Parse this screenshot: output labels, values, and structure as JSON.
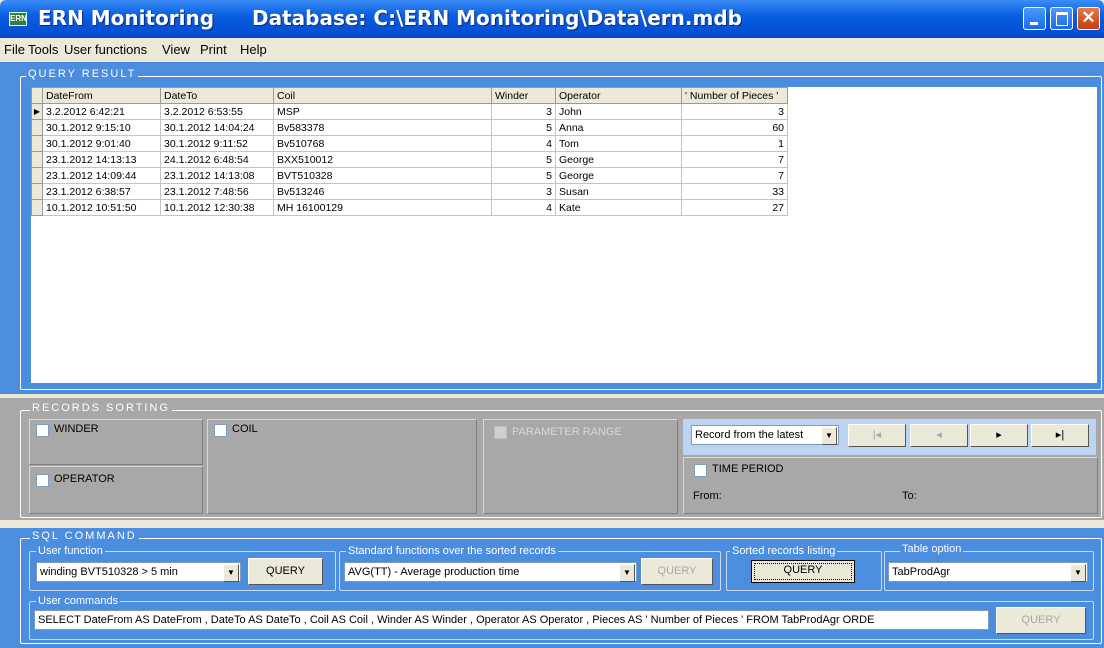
{
  "window": {
    "app_title": "ERN Monitoring",
    "db_title": "Database: C:\\ERN Monitoring\\Data\\ern.mdb",
    "icon_text": "ERN"
  },
  "menu": [
    "File",
    "Tools",
    "User functions",
    "View",
    "Print",
    "Help"
  ],
  "query_result": {
    "legend": "QUERY RESULT",
    "columns": [
      "DateFrom",
      "DateTo",
      "Coil",
      "Winder",
      "Operator",
      "' Number of Pieces '"
    ],
    "rows": [
      [
        "3.2.2012 6:42:21",
        "3.2.2012 6:53:55",
        "MSP",
        "3",
        "John",
        "3"
      ],
      [
        "30.1.2012 9:15:10",
        "30.1.2012 14:04:24",
        "Bv583378",
        "5",
        "Anna",
        "60"
      ],
      [
        "30.1.2012 9:01:40",
        "30.1.2012 9:11:52",
        "Bv510768",
        "4",
        "Tom",
        "1"
      ],
      [
        "23.1.2012 14:13:13",
        "24.1.2012 6:48:54",
        "BXX510012",
        "5",
        "George",
        "7"
      ],
      [
        "23.1.2012 14:09:44",
        "23.1.2012 14:13:08",
        "BVT510328",
        "5",
        "George",
        "7"
      ],
      [
        "23.1.2012 6:38:57",
        "23.1.2012 7:48:56",
        "Bv513246",
        "3",
        "Susan",
        "33"
      ],
      [
        "10.1.2012 10:51:50",
        "10.1.2012 12:30:38",
        "MH 16100129",
        "4",
        "Kate",
        "27"
      ]
    ]
  },
  "sorting": {
    "legend": "RECORDS SORTING",
    "winder": "WINDER",
    "operator": "OPERATOR",
    "coil": "COIL",
    "parameter_range": "PARAMETER RANGE",
    "record_order": "Record from the latest",
    "nav": [
      "|◂",
      "◂",
      "▸",
      "▸|"
    ],
    "time_period": "TIME PERIOD",
    "from": "From:",
    "to": "To:"
  },
  "sql": {
    "legend": "SQL COMMAND",
    "user_function_label": "User function",
    "user_function_value": "winding BVT510328 > 5 min",
    "query": "QUERY",
    "standard_label": "Standard functions over the sorted records",
    "standard_value": "AVG(TT) - Average production time",
    "sorted_label": "Sorted records listing",
    "table_option_label": "Table option",
    "table_option_value": "TabProdAgr",
    "user_commands_label": "User commands",
    "user_commands_value": "SELECT DateFrom AS  DateFrom  , DateTo AS  DateTo  , Coil AS  Coil , Winder AS  Winder , Operator AS  Operator , Pieces AS ' Number of Pieces ' FROM TabProdAgr ORDE"
  }
}
